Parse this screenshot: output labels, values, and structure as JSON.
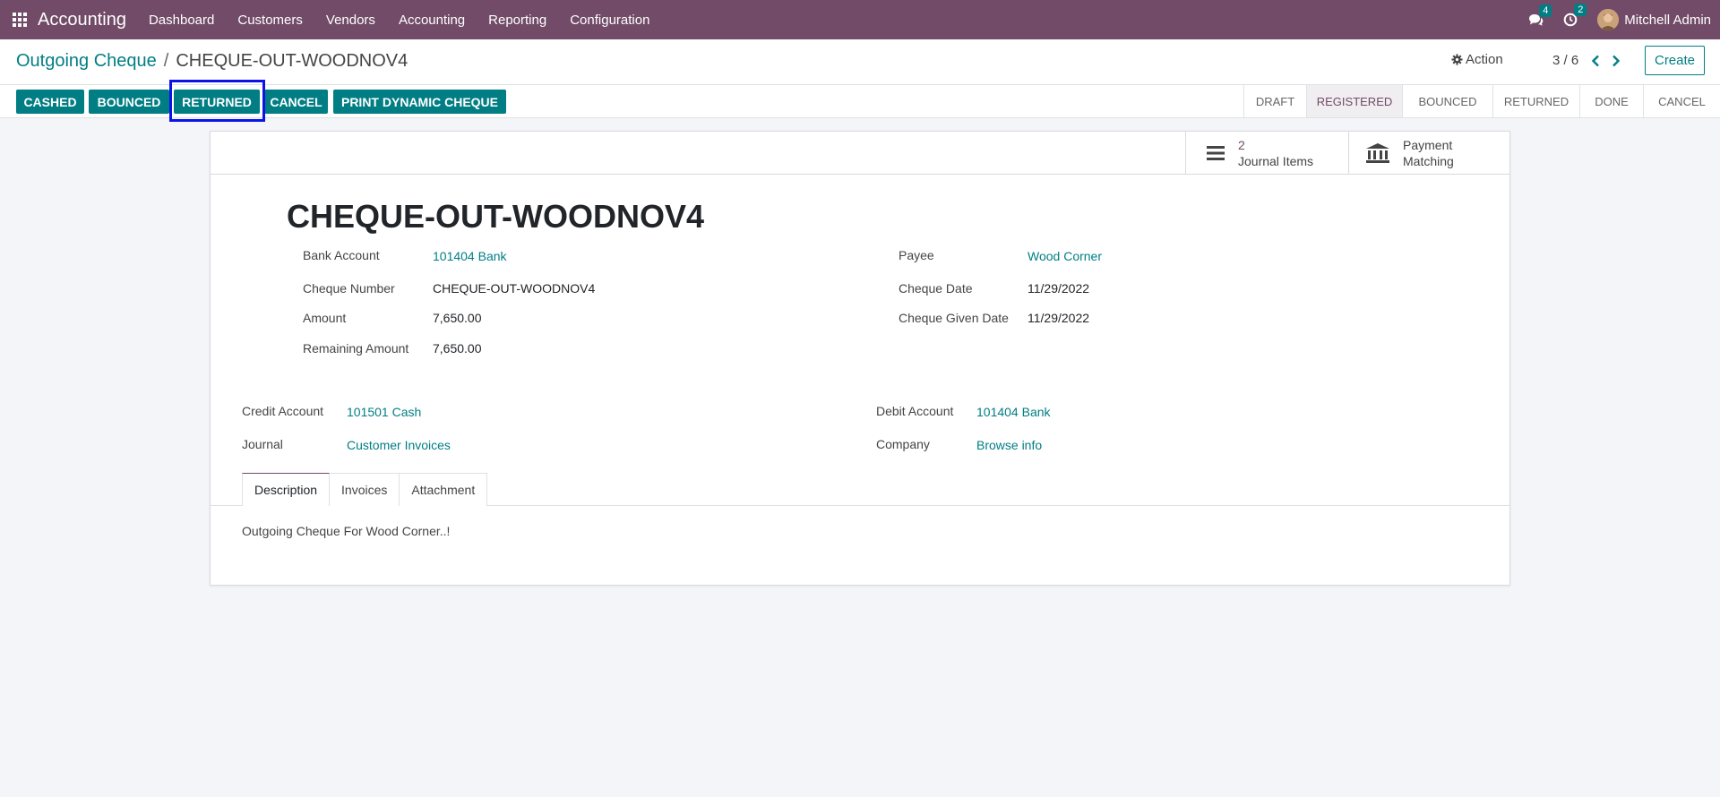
{
  "navbar": {
    "brand": "Accounting",
    "menu": [
      "Dashboard",
      "Customers",
      "Vendors",
      "Accounting",
      "Reporting",
      "Configuration"
    ],
    "messages_count": "4",
    "activities_count": "2",
    "user_name": "Mitchell Admin"
  },
  "breadcrumb": {
    "parent": "Outgoing Cheque",
    "separator": "/",
    "current": "CHEQUE-OUT-WOODNOV4"
  },
  "control": {
    "action_label": "Action",
    "pager": "3 / 6",
    "create_label": "Create"
  },
  "statusbar": {
    "buttons": [
      "CASHED",
      "BOUNCED",
      "RETURNED",
      "CANCEL",
      "PRINT DYNAMIC CHEQUE"
    ],
    "highlighted_button": "RETURNED",
    "stages": [
      "DRAFT",
      "REGISTERED",
      "BOUNCED",
      "RETURNED",
      "DONE",
      "CANCEL"
    ],
    "active_stage": "REGISTERED"
  },
  "smart_buttons": {
    "journal_items_value": "2",
    "journal_items_label": "Journal Items",
    "payment_matching_line1": "Payment",
    "payment_matching_line2": "Matching"
  },
  "record": {
    "title": "CHEQUE-OUT-WOODNOV4",
    "bank_account_label": "Bank Account",
    "bank_account_value": "101404 Bank",
    "cheque_number_label": "Cheque Number",
    "cheque_number_value": "CHEQUE-OUT-WOODNOV4",
    "amount_label": "Amount",
    "amount_value": "7,650.00",
    "remaining_amount_label": "Remaining Amount",
    "remaining_amount_value": "7,650.00",
    "payee_label": "Payee",
    "payee_value": "Wood Corner",
    "cheque_date_label": "Cheque Date",
    "cheque_date_value": "11/29/2022",
    "cheque_given_date_label": "Cheque Given Date",
    "cheque_given_date_value": "11/29/2022",
    "credit_account_label": "Credit Account",
    "credit_account_value": "101501 Cash",
    "journal_label": "Journal",
    "journal_value": "Customer Invoices",
    "debit_account_label": "Debit Account",
    "debit_account_value": "101404 Bank",
    "company_label": "Company",
    "company_value": "Browse info"
  },
  "tabs": [
    "Description",
    "Invoices",
    "Attachment"
  ],
  "active_tab": "Description",
  "description_text": "Outgoing Cheque For Wood Corner..!",
  "colors": {
    "navbar": "#714b67",
    "primary": "#017e84",
    "highlight_box": "#0d13e8"
  }
}
